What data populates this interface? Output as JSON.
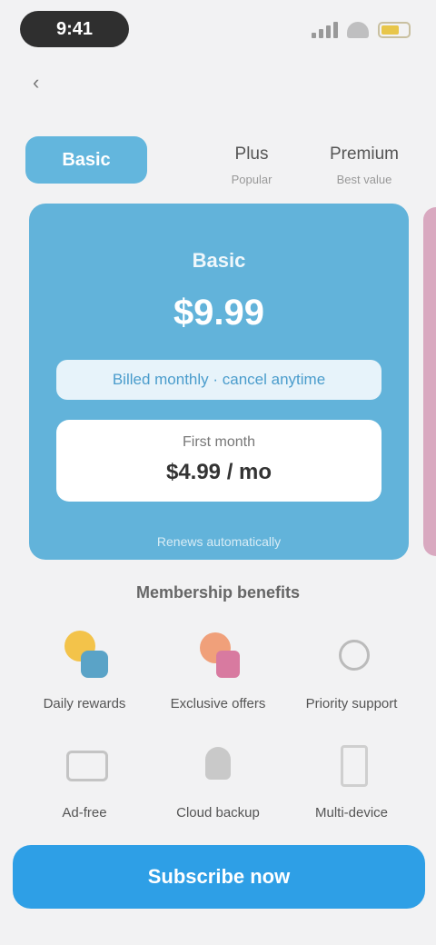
{
  "status_bar": {
    "time": "9:41"
  },
  "tabs": [
    {
      "label": "Basic"
    },
    {
      "label": "Plus",
      "sub": "Popular"
    },
    {
      "label": "Premium",
      "sub": "Best value"
    }
  ],
  "plan_card": {
    "name": "Basic",
    "price": "$9.99",
    "bar_text": "Billed monthly · cancel anytime",
    "box_label": "First month",
    "box_value": "$4.99 / mo",
    "footer": "Renews automatically"
  },
  "benefits": {
    "title": "Membership benefits",
    "items": [
      {
        "label": "Daily rewards",
        "icon": "sun-icon"
      },
      {
        "label": "Exclusive offers",
        "icon": "gift-icon"
      },
      {
        "label": "Priority support",
        "icon": "headset-icon"
      },
      {
        "label": "Ad-free",
        "icon": "screen-icon"
      },
      {
        "label": "Cloud backup",
        "icon": "cloud-icon"
      },
      {
        "label": "Multi-device",
        "icon": "device-icon"
      }
    ]
  },
  "cta": {
    "label": "Subscribe now"
  },
  "colors": {
    "card": "#62b3da",
    "accent": "#2e9fe6",
    "next_card": "#d9a9c0"
  }
}
